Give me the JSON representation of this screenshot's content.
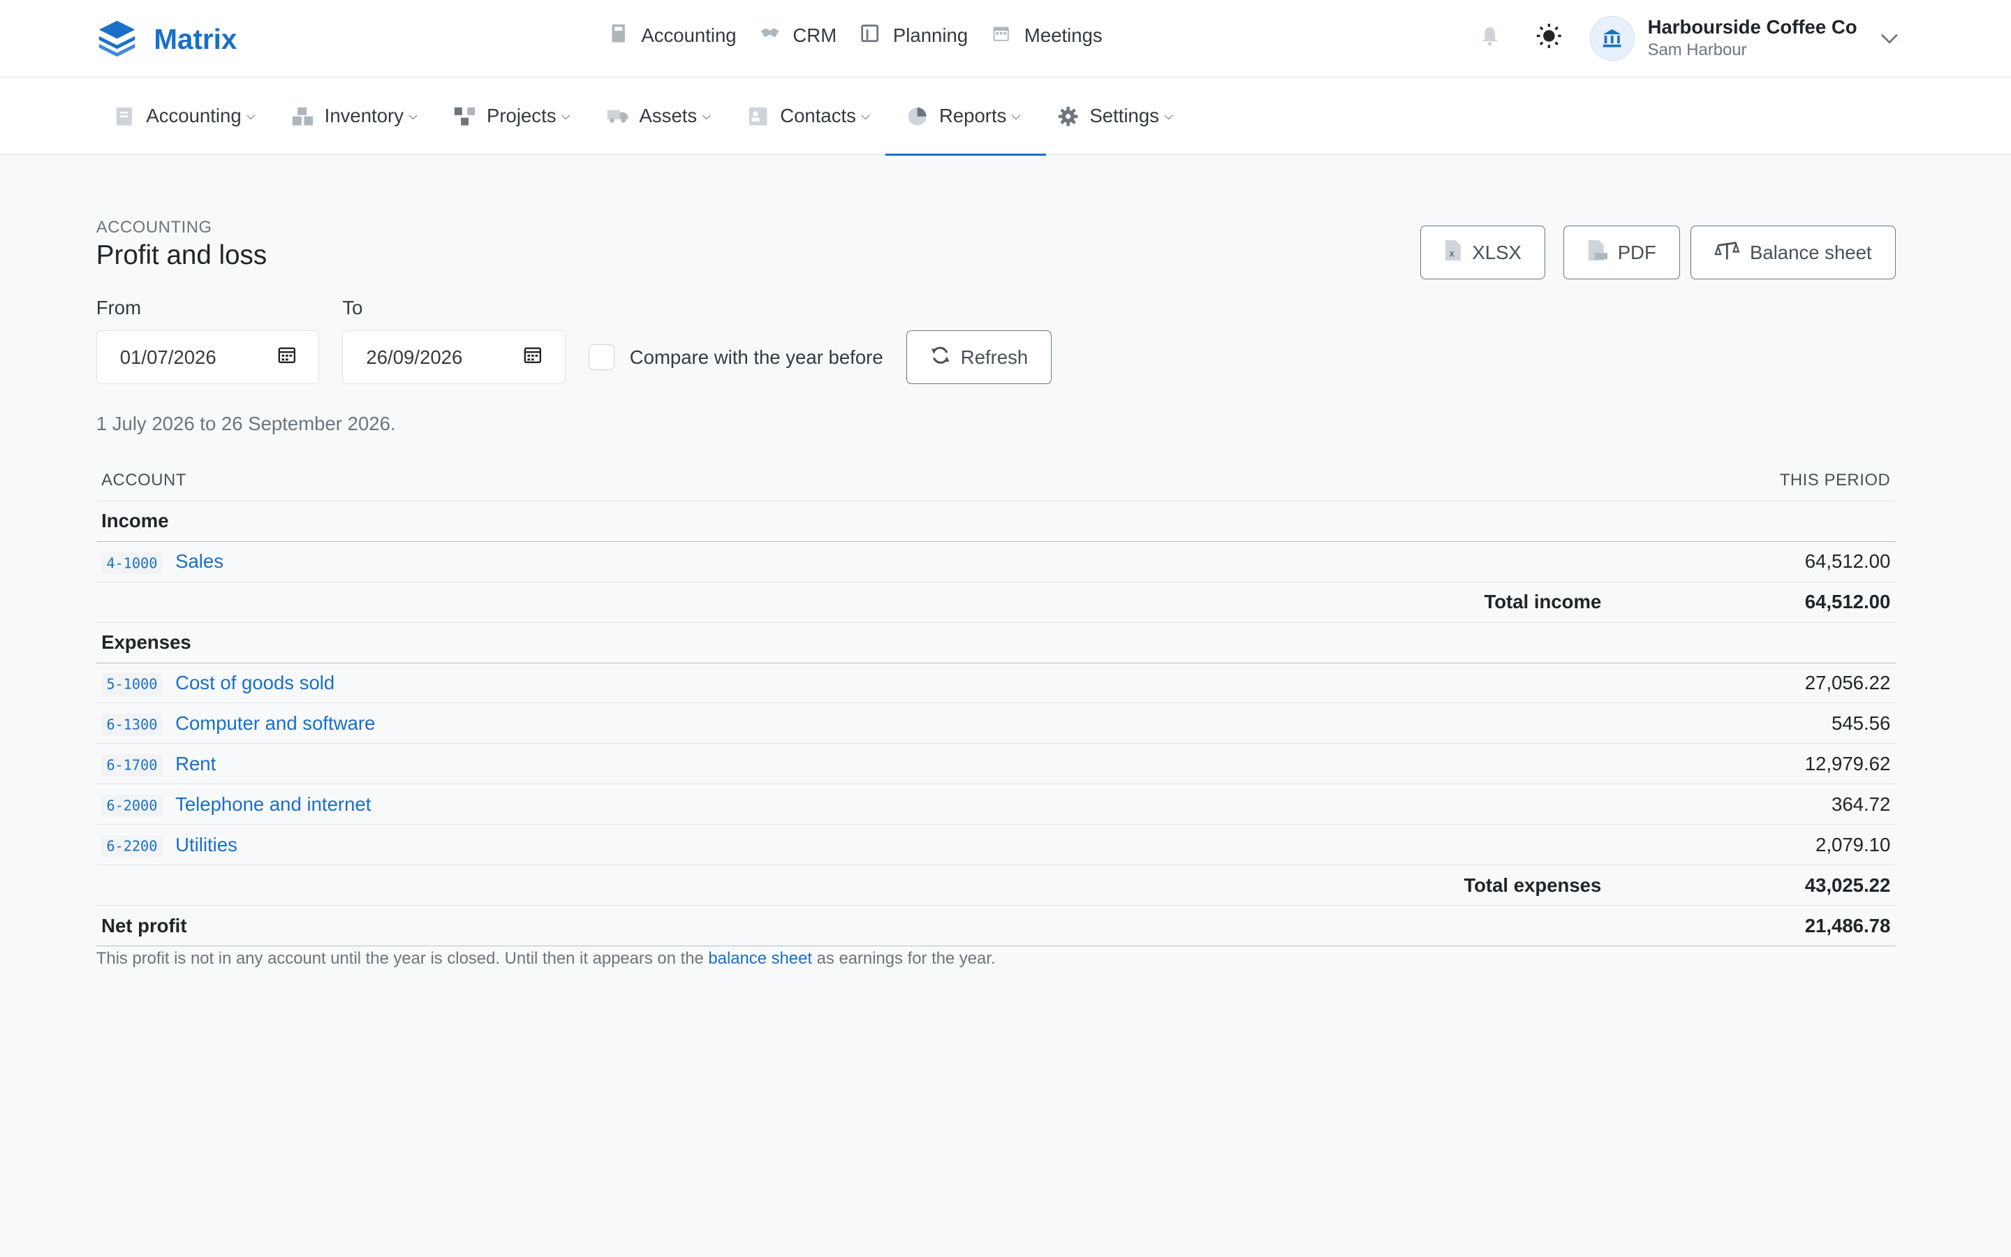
{
  "brand": {
    "name": "Matrix"
  },
  "apps": [
    {
      "label": "Accounting",
      "icon": "calculator-icon"
    },
    {
      "label": "CRM",
      "icon": "handshake-icon"
    },
    {
      "label": "Planning",
      "icon": "planner-icon"
    },
    {
      "label": "Meetings",
      "icon": "calendar-icon"
    }
  ],
  "org": {
    "name": "Harbourside Coffee Co",
    "user": "Sam Harbour"
  },
  "subnav": [
    {
      "label": "Accounting",
      "icon": "ledger-icon"
    },
    {
      "label": "Inventory",
      "icon": "boxes-icon"
    },
    {
      "label": "Projects",
      "icon": "project-icon"
    },
    {
      "label": "Assets",
      "icon": "truck-icon"
    },
    {
      "label": "Contacts",
      "icon": "contact-card-icon"
    },
    {
      "label": "Reports",
      "icon": "pie-chart-icon"
    },
    {
      "label": "Settings",
      "icon": "gear-icon"
    }
  ],
  "page": {
    "eyebrow": "ACCOUNTING",
    "title": "Profit and loss",
    "xlsx_label": "XLSX",
    "pdf_label": "PDF",
    "balance_label": "Balance sheet"
  },
  "filters": {
    "from_label": "From",
    "from_value": "01/07/2026",
    "to_label": "To",
    "to_value": "26/09/2026",
    "compare_label": "Compare with the year before",
    "refresh_label": "Refresh",
    "range_note": "1 July 2026 to 26 September 2026."
  },
  "table": {
    "col_account": "ACCOUNT",
    "col_period": "THIS PERIOD",
    "income_heading": "Income",
    "income": [
      {
        "code": "4-1000",
        "name": "Sales",
        "amount": "64,512.00"
      }
    ],
    "total_income_label": "Total income",
    "total_income": "64,512.00",
    "expenses_heading": "Expenses",
    "expenses": [
      {
        "code": "5-1000",
        "name": "Cost of goods sold",
        "amount": "27,056.22"
      },
      {
        "code": "6-1300",
        "name": "Computer and software",
        "amount": "545.56"
      },
      {
        "code": "6-1700",
        "name": "Rent",
        "amount": "12,979.62"
      },
      {
        "code": "6-2000",
        "name": "Telephone and internet",
        "amount": "364.72"
      },
      {
        "code": "6-2200",
        "name": "Utilities",
        "amount": "2,079.10"
      }
    ],
    "total_expenses_label": "Total expenses",
    "total_expenses": "43,025.22",
    "net_label": "Net profit",
    "net_value": "21,486.78"
  },
  "note": {
    "before": "This profit is not in any account until the year is closed. Until then it appears on the ",
    "link": "balance sheet",
    "after": " as earnings for the year."
  },
  "colors": {
    "accent": "#1a6fc9",
    "border": "#dee2e6",
    "background": "#f8f9fa"
  }
}
